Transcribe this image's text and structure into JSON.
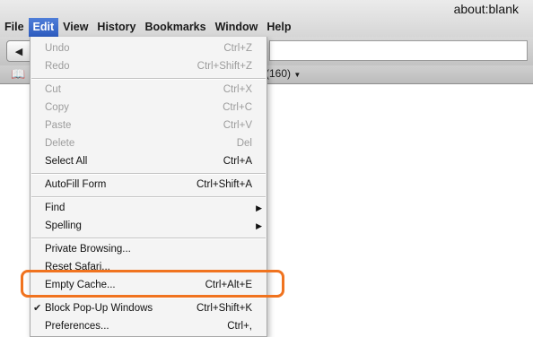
{
  "window": {
    "title": "about:blank"
  },
  "menubar": {
    "items": [
      "File",
      "Edit",
      "View",
      "History",
      "Bookmarks",
      "Window",
      "Help"
    ]
  },
  "toolbar": {
    "back_icon": "back-arrow-icon",
    "back_glyph": "◀"
  },
  "bookmarks_bar": {
    "book_icon": "book-icon",
    "book_glyph": "📖",
    "partial_item": "(160)",
    "dropdown_glyph": "▼"
  },
  "edit_menu": {
    "items": [
      {
        "label": "Undo",
        "shortcut": "Ctrl+Z",
        "enabled": false
      },
      {
        "label": "Redo",
        "shortcut": "Ctrl+Shift+Z",
        "enabled": false
      },
      {
        "label": "Cut",
        "shortcut": "Ctrl+X",
        "enabled": false
      },
      {
        "label": "Copy",
        "shortcut": "Ctrl+C",
        "enabled": false
      },
      {
        "label": "Paste",
        "shortcut": "Ctrl+V",
        "enabled": false
      },
      {
        "label": "Delete",
        "shortcut": "Del",
        "enabled": false
      },
      {
        "label": "Select All",
        "shortcut": "Ctrl+A",
        "enabled": true
      },
      {
        "label": "AutoFill Form",
        "shortcut": "Ctrl+Shift+A",
        "enabled": true
      },
      {
        "label": "Find",
        "shortcut": "",
        "enabled": true,
        "submenu": true
      },
      {
        "label": "Spelling",
        "shortcut": "",
        "enabled": true,
        "submenu": true
      },
      {
        "label": "Private Browsing...",
        "shortcut": "",
        "enabled": true
      },
      {
        "label": "Reset Safari...",
        "shortcut": "",
        "enabled": true
      },
      {
        "label": "Empty Cache...",
        "shortcut": "Ctrl+Alt+E",
        "enabled": true,
        "highlighted": true
      },
      {
        "label": "Block Pop-Up Windows",
        "shortcut": "Ctrl+Shift+K",
        "enabled": true,
        "checked": true
      },
      {
        "label": "Preferences...",
        "shortcut": "Ctrl+,",
        "enabled": true
      }
    ],
    "check_glyph": "✔",
    "submenu_glyph": "▶"
  },
  "colors": {
    "active_menu": "#2d5cc0",
    "highlight_outline": "#f0731f",
    "disabled_text": "#9c9c9c"
  }
}
